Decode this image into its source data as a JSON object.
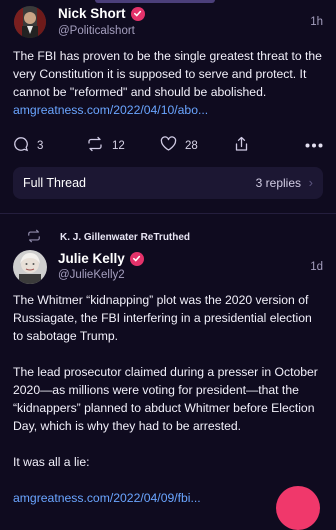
{
  "post1": {
    "author_name": "Nick Short",
    "handle": "@Politicalshort",
    "time": "1h",
    "body": "The FBI has proven to be the single greatest threat to the very Constitution it is supposed to serve and protect. It cannot be \"reformed\" and should be abolished.",
    "link": "amgreatness.com/2022/04/10/abo...",
    "replies": "3",
    "retruths": "12",
    "likes": "28"
  },
  "full_thread": {
    "label": "Full Thread",
    "replies": "3 replies"
  },
  "retruth": {
    "by": "K. J. Gillenwater ReTruthed"
  },
  "post2": {
    "author_name": "Julie Kelly",
    "handle": "@JulieKelly2",
    "time": "1d",
    "para1": "The Whitmer “kidnapping” plot was the 2020 version of Russiagate, the FBI interfering in a presidential election to sabotage Trump.",
    "para2": "The lead prosecutor claimed during a presser in October 2020—as millions were voting for president—that the “kidnappers” planned to abduct Whitmer before Election Day, which is why they had to be arrested.",
    "para3": "It was all a lie:",
    "link": "amgreatness.com/2022/04/09/fbi..."
  },
  "colors": {
    "background": "#0f0b1f",
    "accent_verified": "#e4326a",
    "link": "#6aa5ff",
    "muted": "#a59fbf"
  },
  "icons": {
    "reply": "speech-bubble-icon",
    "retruth": "retruth-arrows-icon",
    "like": "heart-icon",
    "share": "share-icon",
    "more": "more-dots-icon",
    "verified": "verified-badge-icon"
  }
}
